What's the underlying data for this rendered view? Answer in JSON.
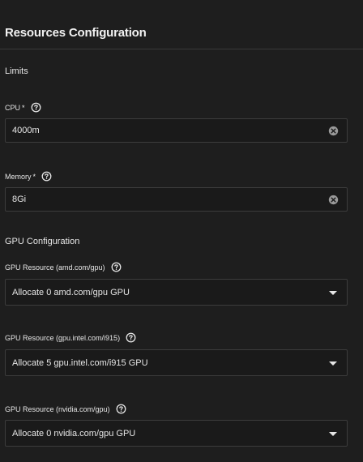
{
  "section": {
    "title": "Resources Configuration"
  },
  "limits": {
    "title": "Limits",
    "cpu": {
      "label": "CPU",
      "required_mark": "*",
      "value": "4000m",
      "help_icon": "help-circle-icon",
      "clear_icon": "clear-circle-icon"
    },
    "memory": {
      "label": "Memory",
      "required_mark": "*",
      "value": "8Gi",
      "help_icon": "help-circle-icon",
      "clear_icon": "clear-circle-icon"
    }
  },
  "gpu": {
    "title": "GPU Configuration",
    "resources": [
      {
        "label": "GPU Resource (amd.com/gpu)",
        "selected": "Allocate 0 amd.com/gpu GPU"
      },
      {
        "label": "GPU Resource (gpu.intel.com/i915)",
        "selected": "Allocate 5 gpu.intel.com/i915 GPU"
      },
      {
        "label": "GPU Resource (nvidia.com/gpu)",
        "selected": "Allocate 0 nvidia.com/gpu GPU"
      }
    ]
  },
  "colors": {
    "background": "#1e1e1e",
    "input_background": "#1a1a1a",
    "border": "#3c3c3c",
    "text": "#e6e6e6"
  }
}
